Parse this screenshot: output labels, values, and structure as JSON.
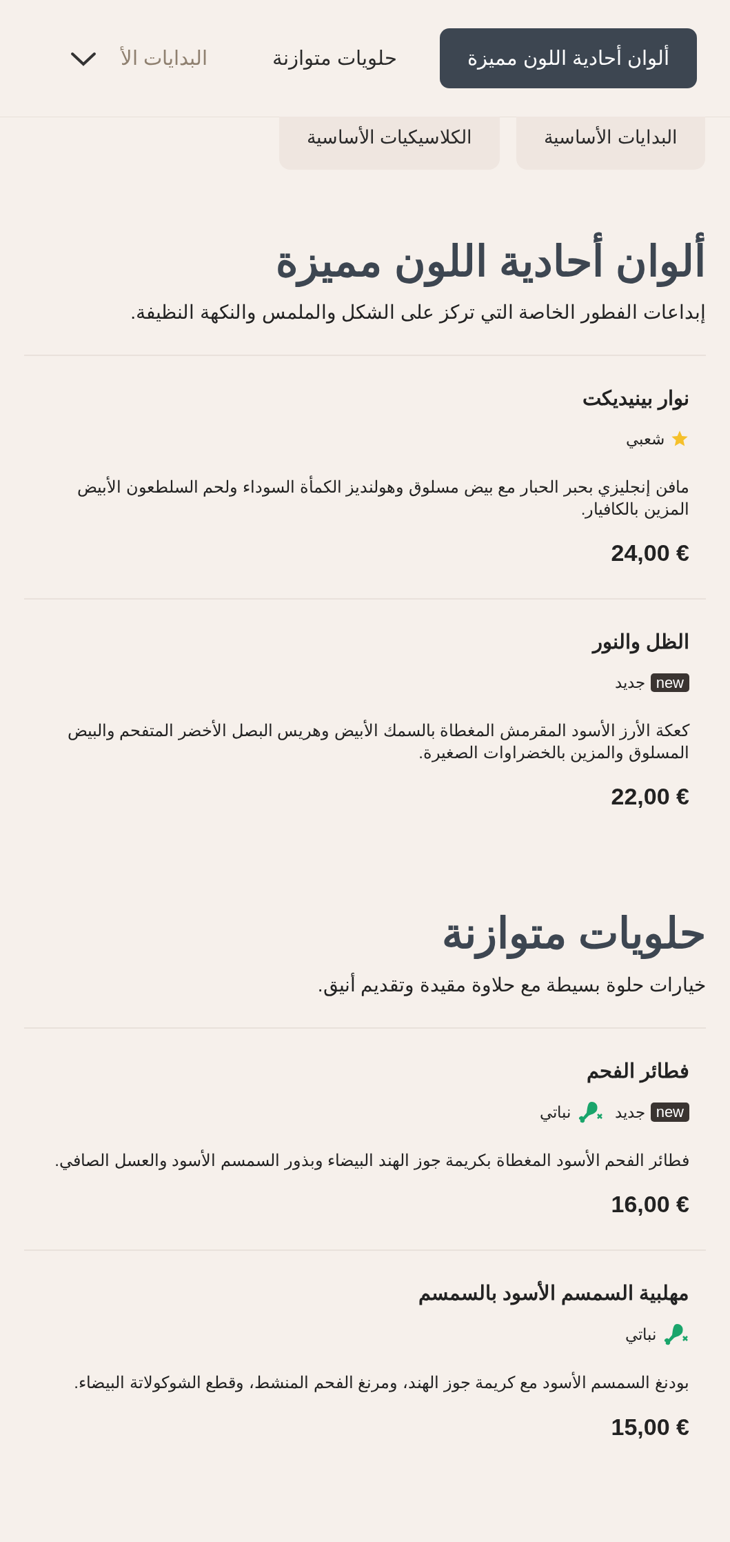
{
  "nav": {
    "tabs": [
      {
        "label": "ألوان أحادية اللون مميزة",
        "selected": true,
        "faded": false
      },
      {
        "label": "حلويات متوازنة",
        "selected": false,
        "faded": false
      },
      {
        "label": "البدايات الأ",
        "selected": false,
        "faded": true
      }
    ]
  },
  "subtabs": [
    {
      "label": "البدايات الأساسية"
    },
    {
      "label": "الكلاسيكيات الأساسية"
    }
  ],
  "sections": [
    {
      "title": "ألوان أحادية اللون مميزة",
      "description": "إبداعات الفطور الخاصة التي تركز على الشكل والملمس والنكهة النظيفة.",
      "items": [
        {
          "name": "نوار بينيديكت",
          "tags": [
            {
              "kind": "popular",
              "label": "شعبي"
            }
          ],
          "description": "مافن إنجليزي بحبر الحبار مع بيض مسلوق وهولنديز الكمأة السوداء ولحم السلطعون الأبيض المزين بالكافيار.",
          "price": "24,00 €"
        },
        {
          "name": "الظل والنور",
          "tags": [
            {
              "kind": "new",
              "badge": "new",
              "label": "جديد"
            }
          ],
          "description": "كعكة الأرز الأسود المقرمش المغطاة بالسمك الأبيض وهريس البصل الأخضر المتفحم والبيض المسلوق والمزين بالخضراوات الصغيرة.",
          "price": "22,00 €"
        }
      ]
    },
    {
      "title": "حلويات متوازنة",
      "description": "خيارات حلوة بسيطة مع حلاوة مقيدة وتقديم أنيق.",
      "items": [
        {
          "name": "فطائر الفحم",
          "tags": [
            {
              "kind": "new",
              "badge": "new",
              "label": "جديد"
            },
            {
              "kind": "vegetarian",
              "label": "نباتي"
            }
          ],
          "description": "فطائر الفحم الأسود المغطاة بكريمة جوز الهند البيضاء وبذور السمسم الأسود والعسل الصافي.",
          "price": "16,00 €"
        },
        {
          "name": "مهلبية السمسم الأسود بالسمسم",
          "tags": [
            {
              "kind": "vegetarian",
              "label": "نباتي"
            }
          ],
          "description": "بودنغ السمسم الأسود مع كريمة جوز الهند، ومرنغ الفحم المنشط، وقطع الشوكولاتة البيضاء.",
          "price": "15,00 €"
        }
      ]
    }
  ]
}
